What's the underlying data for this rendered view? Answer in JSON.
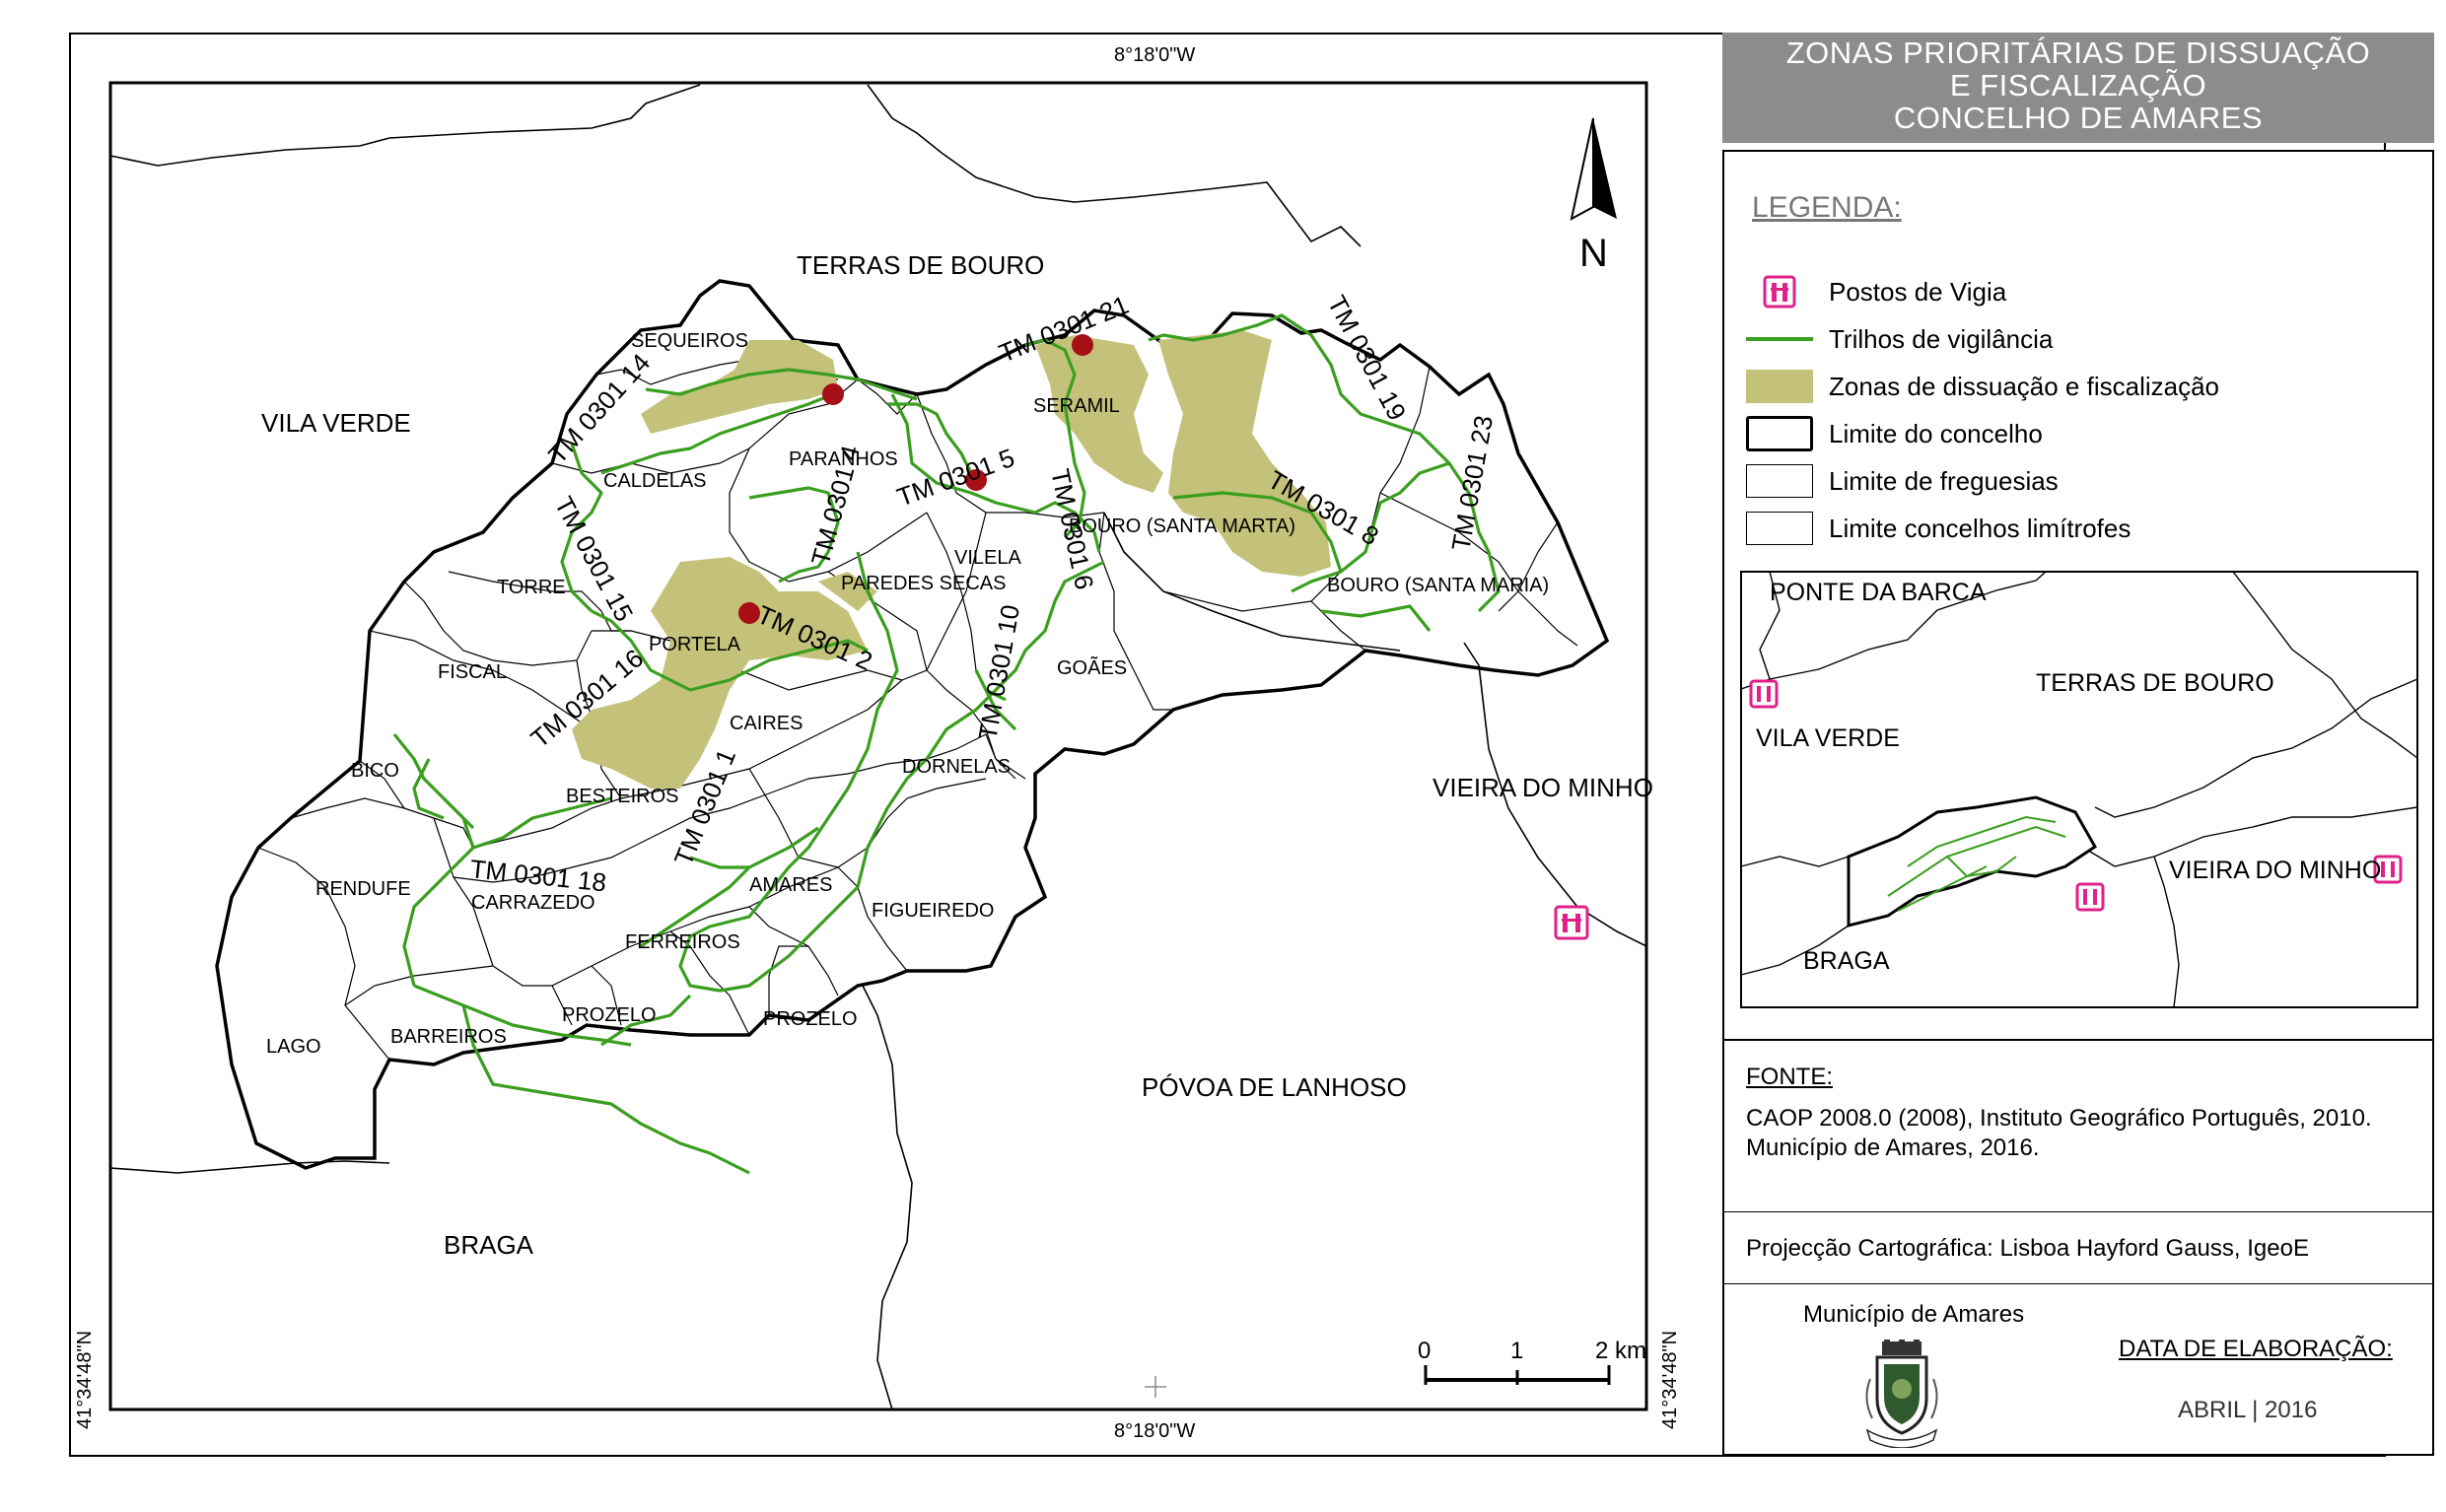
{
  "title": {
    "line1": "ZONAS PRIORITÁRIAS DE DISSUAÇÃO",
    "line2": "E FISCALIZAÇÃO",
    "line3": "CONCELHO DE AMARES"
  },
  "coordinates": {
    "top": "8°18'0\"W",
    "bottom": "8°18'0\"W",
    "left": "41°34'48\"N",
    "right": "41°34'48\"N"
  },
  "north_arrow": {
    "letter": "N",
    "icon": "north-arrow-icon"
  },
  "scale_bar": {
    "ticks": [
      "0",
      "1",
      "2 km"
    ]
  },
  "neighbours": {
    "terras_de_bouro": "TERRAS DE BOURO",
    "vila_verde": "VILA VERDE",
    "vieira_do_minho": "VIEIRA DO MINHO",
    "povoa_de_lanhoso": "PÓVOA DE LANHOSO",
    "braga": "BRAGA"
  },
  "freguesias": {
    "sequeiros": "SEQUEIROS",
    "caldelas": "CALDELAS",
    "paranhos": "PARANHOS",
    "seramil": "SERAMIL",
    "torre": "TORRE",
    "vilela": "VILELA",
    "bouro_santa_marta": "BOURO (SANTA MARTA)",
    "bouro_santa_maria": "BOURO (SANTA MARIA)",
    "paredes_secas": "PAREDES SECAS",
    "portela": "PORTELA",
    "fiscal": "FISCAL",
    "goaes": "GOÃES",
    "caires": "CAIRES",
    "bico": "BICO",
    "dornelas": "DORNELAS",
    "besteiros": "BESTEIROS",
    "rendufe": "RENDUFE",
    "carrazedo": "CARRAZEDO",
    "amares": "AMARES",
    "figueiredo": "FIGUEIREDO",
    "ferreiros": "FERREIROS",
    "lago": "LAGO",
    "barreiros": "BARREIROS",
    "prozelo1": "PROZELO",
    "prozelo2": "PROZELO"
  },
  "trails": {
    "tm21": "TM 0301 21",
    "tm14": "TM 0301 14",
    "tm5": "TM 0301 5",
    "tm15": "TM 0301 15",
    "tm4": "TM 0301 4",
    "tm6": "TM 0301 6",
    "tm8": "TM 0301 8",
    "tm16": "TM 0301 16",
    "tm2": "TM 0301 2",
    "tm10": "TM 0301 10",
    "tm1": "TM 0301 1",
    "tm18": "TM 0301 18",
    "tm19": "TM 0301 19",
    "tm23": "TM 0301 23"
  },
  "legend": {
    "heading": "LEGENDA:",
    "items": [
      {
        "label": "Postos de Vigia",
        "icon": "watchtower-icon",
        "color": "#e0218a"
      },
      {
        "label": "Trilhos de vigilância",
        "color": "#3a9e1f"
      },
      {
        "label": "Zonas de dissuação e fiscalização",
        "color": "#c4c27a"
      },
      {
        "label": "Limite do concelho"
      },
      {
        "label": "Limite de freguesias"
      },
      {
        "label": "Limite concelhos limítrofes"
      }
    ]
  },
  "inset": {
    "ponte_da_barca": "PONTE DA BARCA",
    "terras_de_bouro": "TERRAS DE BOURO",
    "vila_verde": "VILA VERDE",
    "vieira_do_minho": "VIEIRA DO MINHO",
    "braga": "BRAGA"
  },
  "source": {
    "heading": "FONTE:",
    "line1": "CAOP 2008.0 (2008), Instituto Geográfico Português, 2010.",
    "line2": "Município de Amares, 2016."
  },
  "projection": "Projecção Cartográfica: Lisboa Hayford Gauss, IgeoE",
  "municipality": "Município de Amares",
  "date": {
    "heading": "DATA DE ELABORAÇÃO:",
    "value": "ABRIL | 2016"
  },
  "colors": {
    "trail": "#3a9e1f",
    "zone": "#c4c27a",
    "watchtower": "#e0218a",
    "fire_point": "#a50f15",
    "title_bg": "#8c8c8c"
  }
}
